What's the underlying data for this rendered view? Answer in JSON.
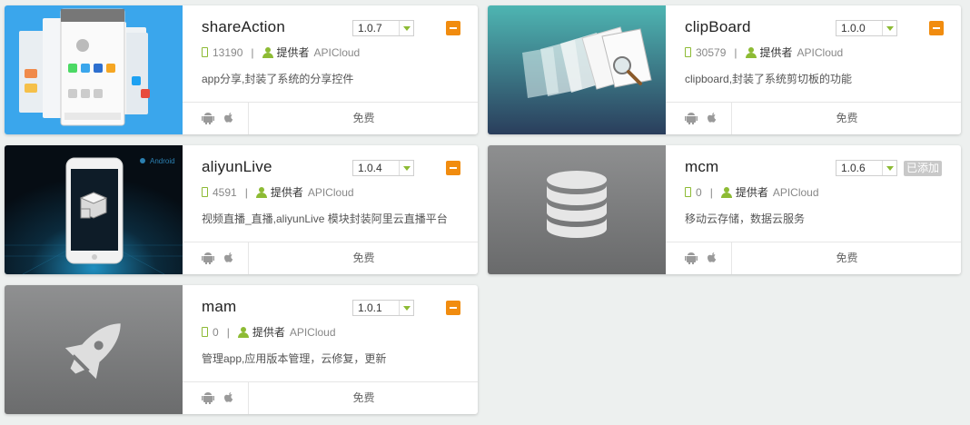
{
  "colors": {
    "accent": "#8dbb34",
    "add": "#f18c0f",
    "added": "#c8c8c8"
  },
  "modules": [
    {
      "title": "shareAction",
      "version": "1.0.7",
      "downloads": "13190",
      "provider_label": "提供者",
      "provider": "APICloud",
      "description": "app分享,封装了系统的分享控件",
      "price": "免费",
      "added": false,
      "thumb_icon": "share-screens-thumbnail"
    },
    {
      "title": "clipBoard",
      "version": "1.0.0",
      "downloads": "30579",
      "provider_label": "提供者",
      "provider": "APICloud",
      "description": "clipboard,封装了系统剪切板的功能",
      "price": "免费",
      "added": false,
      "thumb_icon": "clipboard-thumbnail"
    },
    {
      "title": "aliyunLive",
      "version": "1.0.4",
      "downloads": "4591",
      "provider_label": "提供者",
      "provider": "APICloud",
      "description": "视频直播_直播,aliyunLive 模块封装阿里云直播平台",
      "price": "免费",
      "added": false,
      "thumb_icon": "android-phone-thumbnail",
      "thumb_text": "Android"
    },
    {
      "title": "mcm",
      "version": "1.0.6",
      "downloads": "0",
      "provider_label": "提供者",
      "provider": "APICloud",
      "description": "移动云存储，数据云服务",
      "price": "免费",
      "added": true,
      "added_label": "已添加",
      "thumb_icon": "database-thumbnail"
    },
    {
      "title": "mam",
      "version": "1.0.1",
      "downloads": "0",
      "provider_label": "提供者",
      "provider": "APICloud",
      "description": "管理app,应用版本管理，云修复，更新",
      "price": "免费",
      "added": false,
      "thumb_icon": "rocket-thumbnail"
    }
  ]
}
